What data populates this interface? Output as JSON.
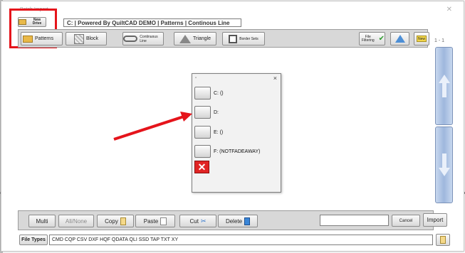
{
  "window": {
    "title": "Batch Import"
  },
  "top": {
    "new_directory_label": "New Drive",
    "path": "C:  |  Powered By QuiltCAD DEMO  |  Patterns  |  Continous Line"
  },
  "toolbar": {
    "patterns": "Patterns",
    "block": "Block",
    "continuous": "Continuous Line",
    "triangle": "Triangle",
    "border_sets": "Border Sets",
    "file_filtering": "File Filtering",
    "new": "New",
    "page": "1 - 1"
  },
  "drive_dialog": {
    "close": "×",
    "drives": [
      {
        "label": "C: ()"
      },
      {
        "label": "D:"
      },
      {
        "label": "E: ()"
      },
      {
        "label": "F: (NOTFADEAWAY)"
      }
    ],
    "cancel_symbol": "✕"
  },
  "bottom": {
    "multi": "Multi",
    "all_none": "All/None",
    "copy": "Copy",
    "paste": "Paste",
    "cut": "Cut",
    "delete": "Delete",
    "name_value": "",
    "cancel": "Cancel",
    "import": "Import",
    "file_types_label": "File Types",
    "file_types": "CMD  CQP  CSV  DXF  HQF  QDATA  QLI  SSD  TAP  TXT  XY"
  },
  "colors": {
    "highlight": "#e5141b",
    "arrow": "#e5141b",
    "scroll_accent": "#9eb7dd",
    "cancel_red": "#e02424"
  }
}
